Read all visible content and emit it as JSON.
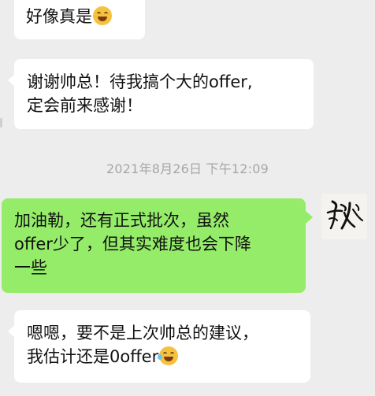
{
  "messages": [
    {
      "text": "好像真是",
      "emoji": "grinning-sweat-emoji"
    },
    {
      "line1": "谢谢帅总！待我搞个大的offer,",
      "line2": "定会前来感谢！"
    },
    {
      "line1": "加油勒，还有正式批次，虽然",
      "line2": "offer少了，但其实难度也会下降",
      "line3": "一些"
    },
    {
      "line1": "嗯嗯，要不是上次帅总的建议，",
      "line2": "我估计还是0offer",
      "emoji": "laughing-tears-emoji"
    }
  ],
  "timestamp": "2021年8月26日 下午12:09",
  "colors": {
    "background": "#ededed",
    "incoming_bubble": "#ffffff",
    "outgoing_bubble": "#95ec69",
    "timestamp_text": "#a6a6a6"
  }
}
